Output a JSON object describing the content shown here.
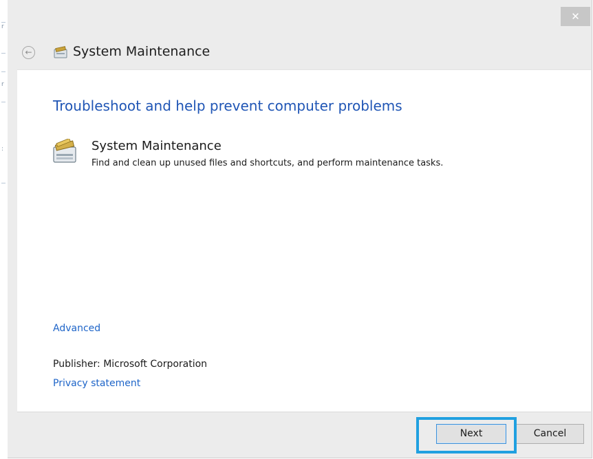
{
  "window": {
    "title": "System Maintenance",
    "close_glyph": "✕",
    "back_glyph": "←",
    "title_icon": "system-maintenance-icon"
  },
  "main": {
    "heading": "Troubleshoot and help prevent computer problems",
    "task": {
      "title": "System Maintenance",
      "description": "Find and clean up unused files and shortcuts, and perform maintenance tasks.",
      "icon": "system-maintenance-icon"
    },
    "advanced_link": "Advanced",
    "publisher": "Publisher:  Microsoft Corporation",
    "privacy_link": "Privacy statement"
  },
  "footer": {
    "next_label": "Next",
    "cancel_label": "Cancel"
  },
  "colors": {
    "link": "#1d64c8",
    "heading": "#1f55b5",
    "highlight": "#20a0e0"
  }
}
